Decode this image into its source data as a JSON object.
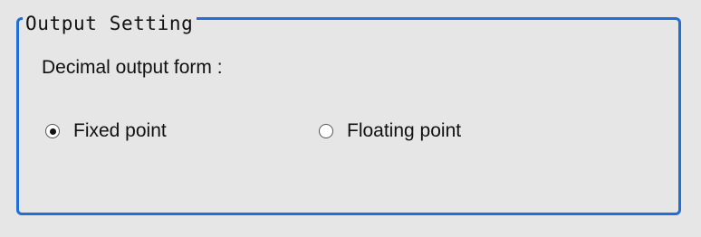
{
  "group": {
    "title": "Output Setting"
  },
  "decimal_output": {
    "label": "Decimal output form :",
    "options": [
      {
        "label": "Fixed point",
        "selected": true
      },
      {
        "label": "Floating point",
        "selected": false
      }
    ]
  },
  "colors": {
    "border": "#1f6fd6",
    "background": "#e6e6e6"
  }
}
